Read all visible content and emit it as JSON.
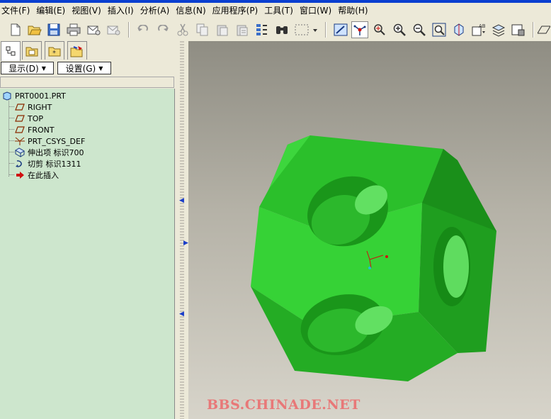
{
  "menubar": {
    "items": [
      {
        "label": "文件(F)"
      },
      {
        "label": "编辑(E)"
      },
      {
        "label": "视图(V)"
      },
      {
        "label": "插入(I)"
      },
      {
        "label": "分析(A)"
      },
      {
        "label": "信息(N)"
      },
      {
        "label": "应用程序(P)"
      },
      {
        "label": "工具(T)"
      },
      {
        "label": "窗口(W)"
      },
      {
        "label": "帮助(H)"
      }
    ]
  },
  "panel": {
    "display_label": "显示(D)",
    "settings_label": "设置(G)"
  },
  "tree": {
    "root": "PRT0001.PRT",
    "items": [
      {
        "label": "RIGHT"
      },
      {
        "label": "TOP"
      },
      {
        "label": "FRONT"
      },
      {
        "label": "PRT_CSYS_DEF"
      },
      {
        "label": "伸出项 标识700"
      },
      {
        "label": "切剪 标识1311"
      },
      {
        "label": "在此插入"
      }
    ]
  },
  "viewport": {
    "watermark": "BBS.CHINADE.NET"
  },
  "colors": {
    "tree_bg": "#cde6cd",
    "model_green": "#2fc92f",
    "watermark": "#e87878"
  }
}
